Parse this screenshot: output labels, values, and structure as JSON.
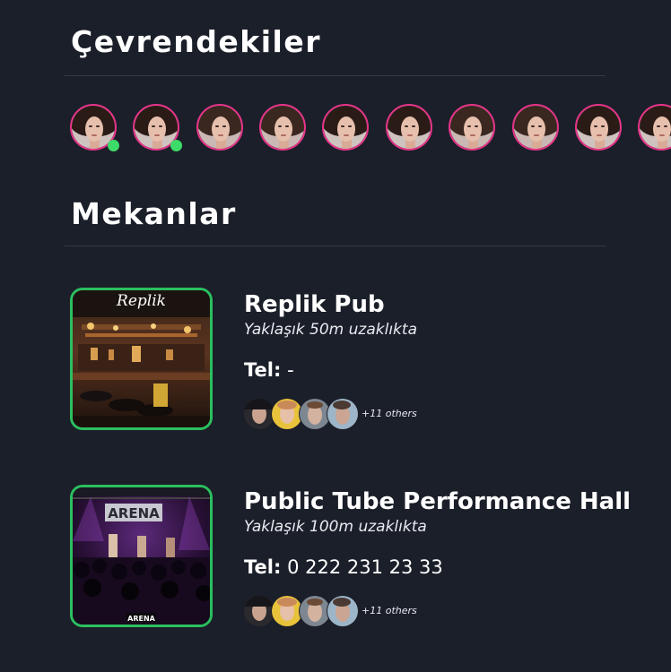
{
  "sections": {
    "nearby_title": "Çevrendekiler",
    "venues_title": "Mekanlar"
  },
  "nearby": [
    {
      "online": true
    },
    {
      "online": true
    },
    {
      "online": false
    },
    {
      "online": false
    },
    {
      "online": false
    },
    {
      "online": false
    },
    {
      "online": false
    },
    {
      "online": false
    },
    {
      "online": false
    },
    {
      "online": false
    }
  ],
  "venues": [
    {
      "name": "Replik Pub",
      "distance": "Yaklaşık 50m uzaklıkta",
      "tel_label": "Tel:",
      "tel_value": "-",
      "others": "+11 others",
      "logo": "Replik",
      "image": "bar-interior"
    },
    {
      "name": "Public Tube Performance Hall",
      "distance": "Yaklaşık 100m uzaklıkta",
      "tel_label": "Tel:",
      "tel_value": "0 222 231 23 33",
      "others": "+11 others",
      "logo": "ARENA",
      "image": "concert-stage"
    }
  ],
  "colors": {
    "background": "#1b1f29",
    "avatar_ring": "#e8338a",
    "online": "#3ddb68",
    "venue_border": "#2bbf5f"
  }
}
